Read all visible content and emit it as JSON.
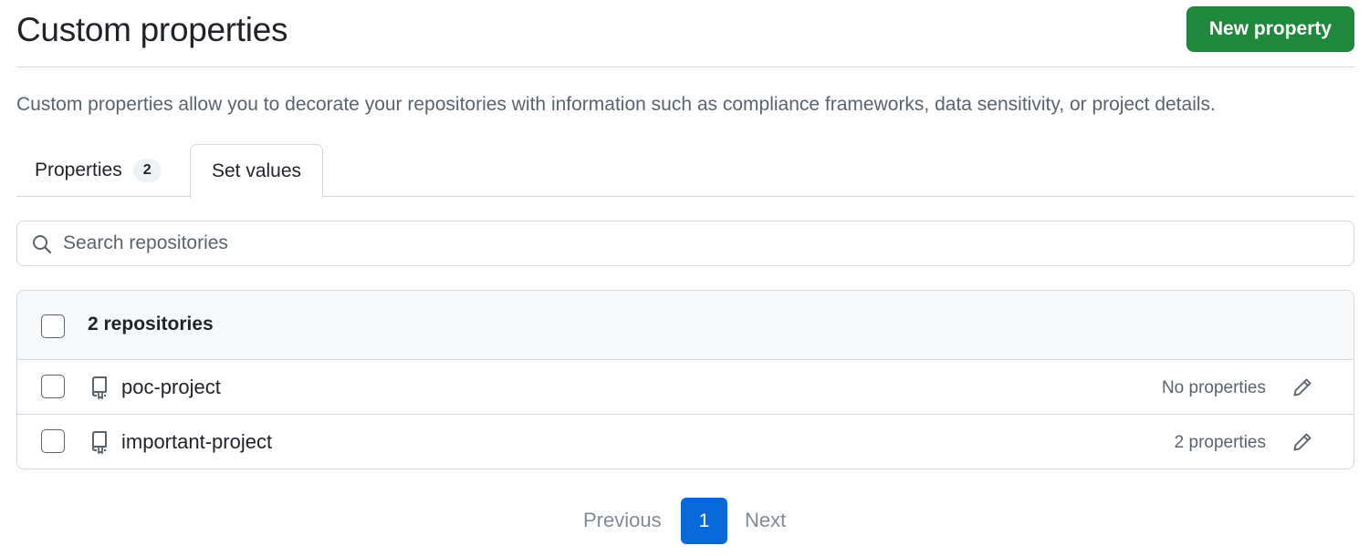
{
  "header": {
    "title": "Custom properties",
    "new_button": "New property"
  },
  "description": "Custom properties allow you to decorate your repositories with information such as compliance frameworks, data sensitivity, or project details.",
  "tabs": [
    {
      "label": "Properties",
      "counter": "2",
      "selected": false
    },
    {
      "label": "Set values",
      "selected": true
    }
  ],
  "search": {
    "placeholder": "Search repositories",
    "value": ""
  },
  "table": {
    "header_label": "2 repositories",
    "rows": [
      {
        "name": "poc-project",
        "properties": "No properties"
      },
      {
        "name": "important-project",
        "properties": "2 properties"
      }
    ]
  },
  "pagination": {
    "previous": "Previous",
    "current": "1",
    "next": "Next"
  },
  "colors": {
    "primary_button": "#1f883d",
    "accent": "#0969da",
    "border": "#d0d7de",
    "muted_text": "#59636e"
  }
}
